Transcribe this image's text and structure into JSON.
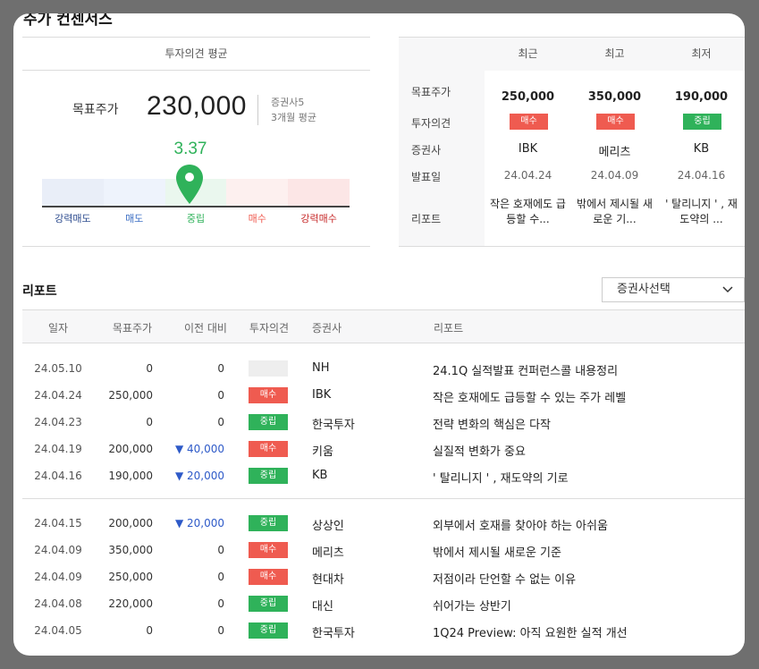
{
  "section_title": "주가 컨센서스",
  "consensus": {
    "avg_header": "투자의견 평균",
    "target_label": "목표주가",
    "target_value": "230,000",
    "meta_firms": "증권사5",
    "meta_period": "3개월 평균",
    "score": "3.37",
    "gauge_labels": [
      "강력매도",
      "매도",
      "중립",
      "매수",
      "강력매수"
    ],
    "gauge_colors": [
      "#2e4c8f",
      "#3d6fc4",
      "#2fb25a",
      "#ef5b50",
      "#c62828"
    ]
  },
  "summary": {
    "row_labels": [
      "목표주가",
      "투자의견",
      "증권사",
      "발표일",
      "리포트"
    ],
    "columns": [
      {
        "head": "최근",
        "price": "250,000",
        "opinion": "매수",
        "opinion_type": "buy",
        "firm": "IBK",
        "date": "24.04.24",
        "report": "작은 호재에도 급등할 수..."
      },
      {
        "head": "최고",
        "price": "350,000",
        "opinion": "매수",
        "opinion_type": "buy",
        "firm": "메리츠",
        "date": "24.04.09",
        "report": "밖에서 제시될 새로운 기..."
      },
      {
        "head": "최저",
        "price": "190,000",
        "opinion": "중립",
        "opinion_type": "neutral",
        "firm": "KB",
        "date": "24.04.16",
        "report": "' 탈리니지 ' , 재도약의 ..."
      }
    ]
  },
  "reports": {
    "title": "리포트",
    "firm_select": "증권사선택",
    "headers": [
      "일자",
      "목표주가",
      "이전 대비",
      "투자의견",
      "증권사",
      "리포트"
    ],
    "rows": [
      {
        "date": "24.05.10",
        "price": "0",
        "diff": "0",
        "diff_dir": "none",
        "opinion": "",
        "opinion_type": "empty",
        "firm": "NH",
        "report": "24.1Q 실적발표 컨퍼런스콜 내용정리"
      },
      {
        "date": "24.04.24",
        "price": "250,000",
        "diff": "0",
        "diff_dir": "none",
        "opinion": "매수",
        "opinion_type": "buy",
        "firm": "IBK",
        "report": "작은 호재에도 급등할 수 있는 주가 레벨"
      },
      {
        "date": "24.04.23",
        "price": "0",
        "diff": "0",
        "diff_dir": "none",
        "opinion": "중립",
        "opinion_type": "neutral",
        "firm": "한국투자",
        "report": "전략 변화의 핵심은 다작"
      },
      {
        "date": "24.04.19",
        "price": "200,000",
        "diff": "▼ 40,000",
        "diff_dir": "down",
        "opinion": "매수",
        "opinion_type": "buy",
        "firm": "키움",
        "report": "실질적 변화가 중요"
      },
      {
        "date": "24.04.16",
        "price": "190,000",
        "diff": "▼ 20,000",
        "diff_dir": "down",
        "opinion": "중립",
        "opinion_type": "neutral",
        "firm": "KB",
        "report": "' 탈리니지 ' , 재도약의 기로"
      },
      {
        "date": "24.04.15",
        "price": "200,000",
        "diff": "▼ 20,000",
        "diff_dir": "down",
        "opinion": "중립",
        "opinion_type": "neutral",
        "firm": "상상인",
        "report": "외부에서 호재를 찾아야 하는 아쉬움"
      },
      {
        "date": "24.04.09",
        "price": "350,000",
        "diff": "0",
        "diff_dir": "none",
        "opinion": "매수",
        "opinion_type": "buy",
        "firm": "메리츠",
        "report": "밖에서 제시될 새로운 기준"
      },
      {
        "date": "24.04.09",
        "price": "250,000",
        "diff": "0",
        "diff_dir": "none",
        "opinion": "매수",
        "opinion_type": "buy",
        "firm": "현대차",
        "report": "저점이라 단언할 수 없는 이유"
      },
      {
        "date": "24.04.08",
        "price": "220,000",
        "diff": "0",
        "diff_dir": "none",
        "opinion": "중립",
        "opinion_type": "neutral",
        "firm": "대신",
        "report": "쉬어가는 상반기"
      },
      {
        "date": "24.04.05",
        "price": "0",
        "diff": "0",
        "diff_dir": "none",
        "opinion": "중립",
        "opinion_type": "neutral",
        "firm": "한국투자",
        "report": "1Q24 Preview: 아직 요원한 실적 개선"
      }
    ]
  }
}
